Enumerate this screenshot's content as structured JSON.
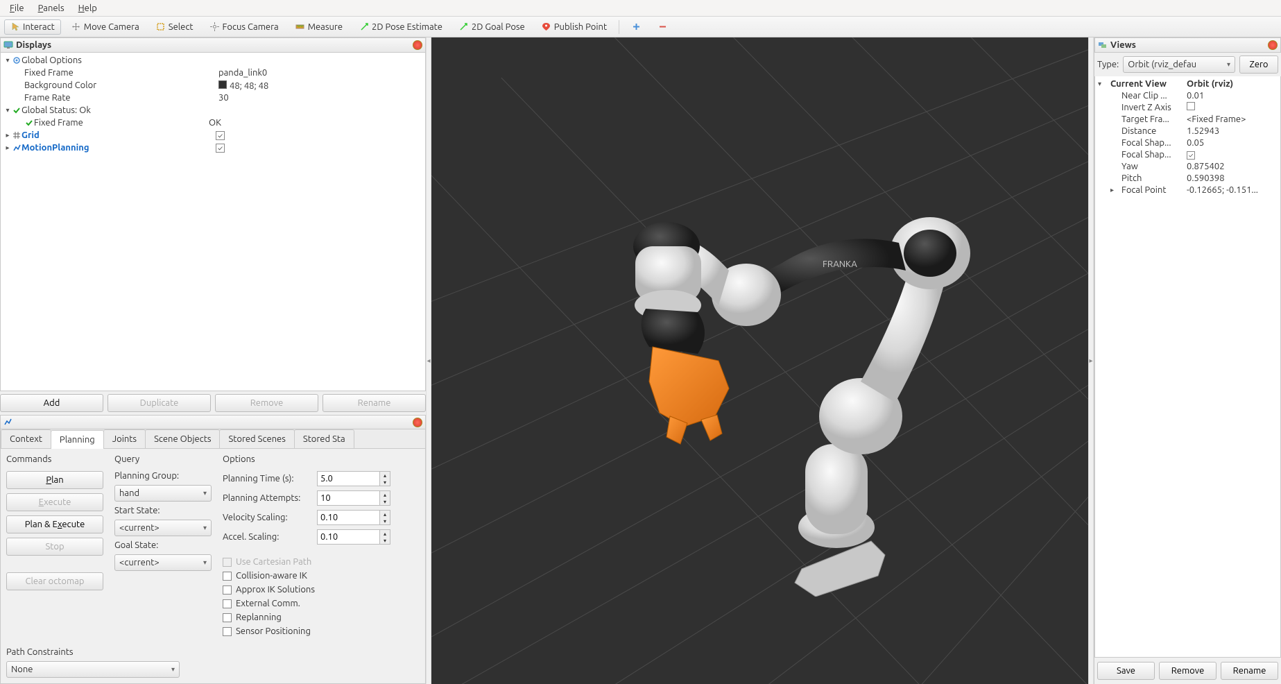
{
  "menubar": {
    "file": "File",
    "panels": "Panels",
    "help": "Help"
  },
  "toolbar": {
    "interact": "Interact",
    "move_camera": "Move Camera",
    "select": "Select",
    "focus_camera": "Focus Camera",
    "measure": "Measure",
    "pose_estimate": "2D Pose Estimate",
    "nav_goal": "2D Goal Pose",
    "publish_point": "Publish Point"
  },
  "displays": {
    "title": "Displays",
    "add": "Add",
    "duplicate": "Duplicate",
    "remove": "Remove",
    "rename": "Rename",
    "tree": {
      "global_options": "Global Options",
      "fixed_frame_lbl": "Fixed Frame",
      "fixed_frame_val": "panda_link0",
      "bg_color_lbl": "Background Color",
      "bg_color_val": "48; 48; 48",
      "frame_rate_lbl": "Frame Rate",
      "frame_rate_val": "30",
      "global_status": "Global Status: Ok",
      "fixed_frame_status_lbl": "Fixed Frame",
      "fixed_frame_status_val": "OK",
      "grid": "Grid",
      "motion_planning": "MotionPlanning"
    }
  },
  "mp": {
    "tabs": {
      "context": "Context",
      "planning": "Planning",
      "joints": "Joints",
      "scene_objects": "Scene Objects",
      "stored_scenes": "Stored Scenes",
      "stored_states": "Stored Sta"
    },
    "commands": {
      "title": "Commands",
      "plan": "Plan",
      "execute": "Execute",
      "plan_execute": "Plan & Execute",
      "stop": "Stop",
      "clear_octomap": "Clear octomap"
    },
    "query": {
      "title": "Query",
      "planning_group_lbl": "Planning Group:",
      "planning_group_val": "hand",
      "start_state_lbl": "Start State:",
      "start_state_val": "<current>",
      "goal_state_lbl": "Goal State:",
      "goal_state_val": "<current>"
    },
    "options": {
      "title": "Options",
      "planning_time_lbl": "Planning Time (s):",
      "planning_time_val": "5.0",
      "planning_attempts_lbl": "Planning Attempts:",
      "planning_attempts_val": "10",
      "vel_scaling_lbl": "Velocity Scaling:",
      "vel_scaling_val": "0.10",
      "accel_scaling_lbl": "Accel. Scaling:",
      "accel_scaling_val": "0.10",
      "use_cartesian": "Use Cartesian Path",
      "collision_ik": "Collision-aware IK",
      "approx_ik": "Approx IK Solutions",
      "external_comm": "External Comm.",
      "replanning": "Replanning",
      "sensor_pos": "Sensor Positioning"
    },
    "path_constraints": {
      "title": "Path Constraints",
      "val": "None"
    }
  },
  "views": {
    "title": "Views",
    "type_lbl": "Type:",
    "type_val": "Orbit (rviz_defau",
    "zero": "Zero",
    "save": "Save",
    "remove": "Remove",
    "rename": "Rename",
    "props": {
      "current_view_lbl": "Current View",
      "current_view_val": "Orbit (rviz)",
      "near_clip_lbl": "Near Clip ...",
      "near_clip_val": "0.01",
      "invert_z_lbl": "Invert Z Axis",
      "target_frame_lbl": "Target Fra...",
      "target_frame_val": "<Fixed Frame>",
      "distance_lbl": "Distance",
      "distance_val": "1.52943",
      "focal_size_lbl": "Focal Shap...",
      "focal_size_val": "0.05",
      "focal_fixed_lbl": "Focal Shap...",
      "yaw_lbl": "Yaw",
      "yaw_val": "0.875402",
      "pitch_lbl": "Pitch",
      "pitch_val": "0.590398",
      "focal_point_lbl": "Focal Point",
      "focal_point_val": "-0.12665; -0.151..."
    }
  },
  "robot_brand": "FRANKA"
}
